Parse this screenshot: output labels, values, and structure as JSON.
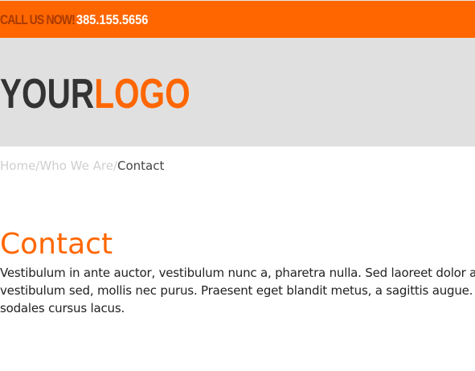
{
  "topbar": {
    "call_label": "CALL US NOW!",
    "phone": "385.155.5656"
  },
  "logo": {
    "part1": "YOUR",
    "part2": "LOGO"
  },
  "breadcrumb": {
    "items": [
      "Home",
      "Who We Are"
    ],
    "separator": "/",
    "current": "Contact"
  },
  "main": {
    "title": "Contact",
    "body_lines": [
      "Vestibulum in ante auctor, vestibulum nunc a, pharetra nulla. Sed laoreet dolor a",
      "vestibulum sed, mollis nec purus. Praesent eget blandit metus, a sagittis augue.",
      "sodales cursus lacus."
    ]
  },
  "colors": {
    "accent": "#ff6600",
    "header_bg": "#e0e0e0",
    "logo_dark": "#333333",
    "breadcrumb_muted": "#cfcfcf"
  }
}
